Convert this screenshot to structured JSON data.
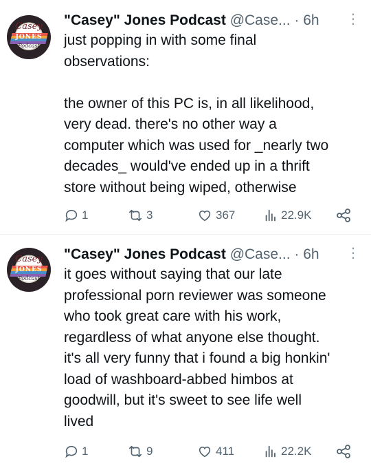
{
  "tweets": [
    {
      "author": {
        "name": "\"Casey\" Jones Podcast",
        "handle": "@Case...",
        "avatar_text": [
          "Casey",
          "JONES",
          "Podcast"
        ]
      },
      "separator": "·",
      "time": "6h",
      "body": {
        "paragraph_1": [
          "just popping in with some final",
          "observations:"
        ],
        "paragraph_2": [
          "the owner of this PC is, in all likelihood,",
          "very dead. there's no other way a",
          "computer which was used for _nearly two",
          "decades_ would've ended up in a thrift",
          "store without being wiped, otherwise"
        ]
      },
      "stats": {
        "replies": "1",
        "reposts": "3",
        "likes": "367",
        "views": "22.9K"
      },
      "icons": [
        "more-icon",
        "reply-icon",
        "repost-icon",
        "like-icon",
        "views-icon",
        "share-icon"
      ]
    },
    {
      "author": {
        "name": "\"Casey\" Jones Podcast",
        "handle": "@Case...",
        "avatar_text": [
          "Casey",
          "JONES",
          "Podcast"
        ]
      },
      "separator": "·",
      "time": "6h",
      "body": {
        "paragraph_1": [
          "it goes without saying that our late",
          "professional porn reviewer was someone",
          "who took great care with his work,",
          "regardless of what anyone else thought.",
          "it's all very funny that i found a big honkin'",
          "load of washboard-abbed himbos at",
          "goodwill, but it's sweet to see life well",
          "lived"
        ]
      },
      "stats": {
        "replies": "1",
        "reposts": "9",
        "likes": "411",
        "views": "22.2K"
      },
      "icons": [
        "more-icon",
        "reply-icon",
        "repost-icon",
        "like-icon",
        "views-icon",
        "share-icon"
      ]
    }
  ],
  "colors": {
    "text": "#0f1419",
    "secondary": "#536471",
    "divider": "#eff3f4",
    "background": "#ffffff"
  }
}
